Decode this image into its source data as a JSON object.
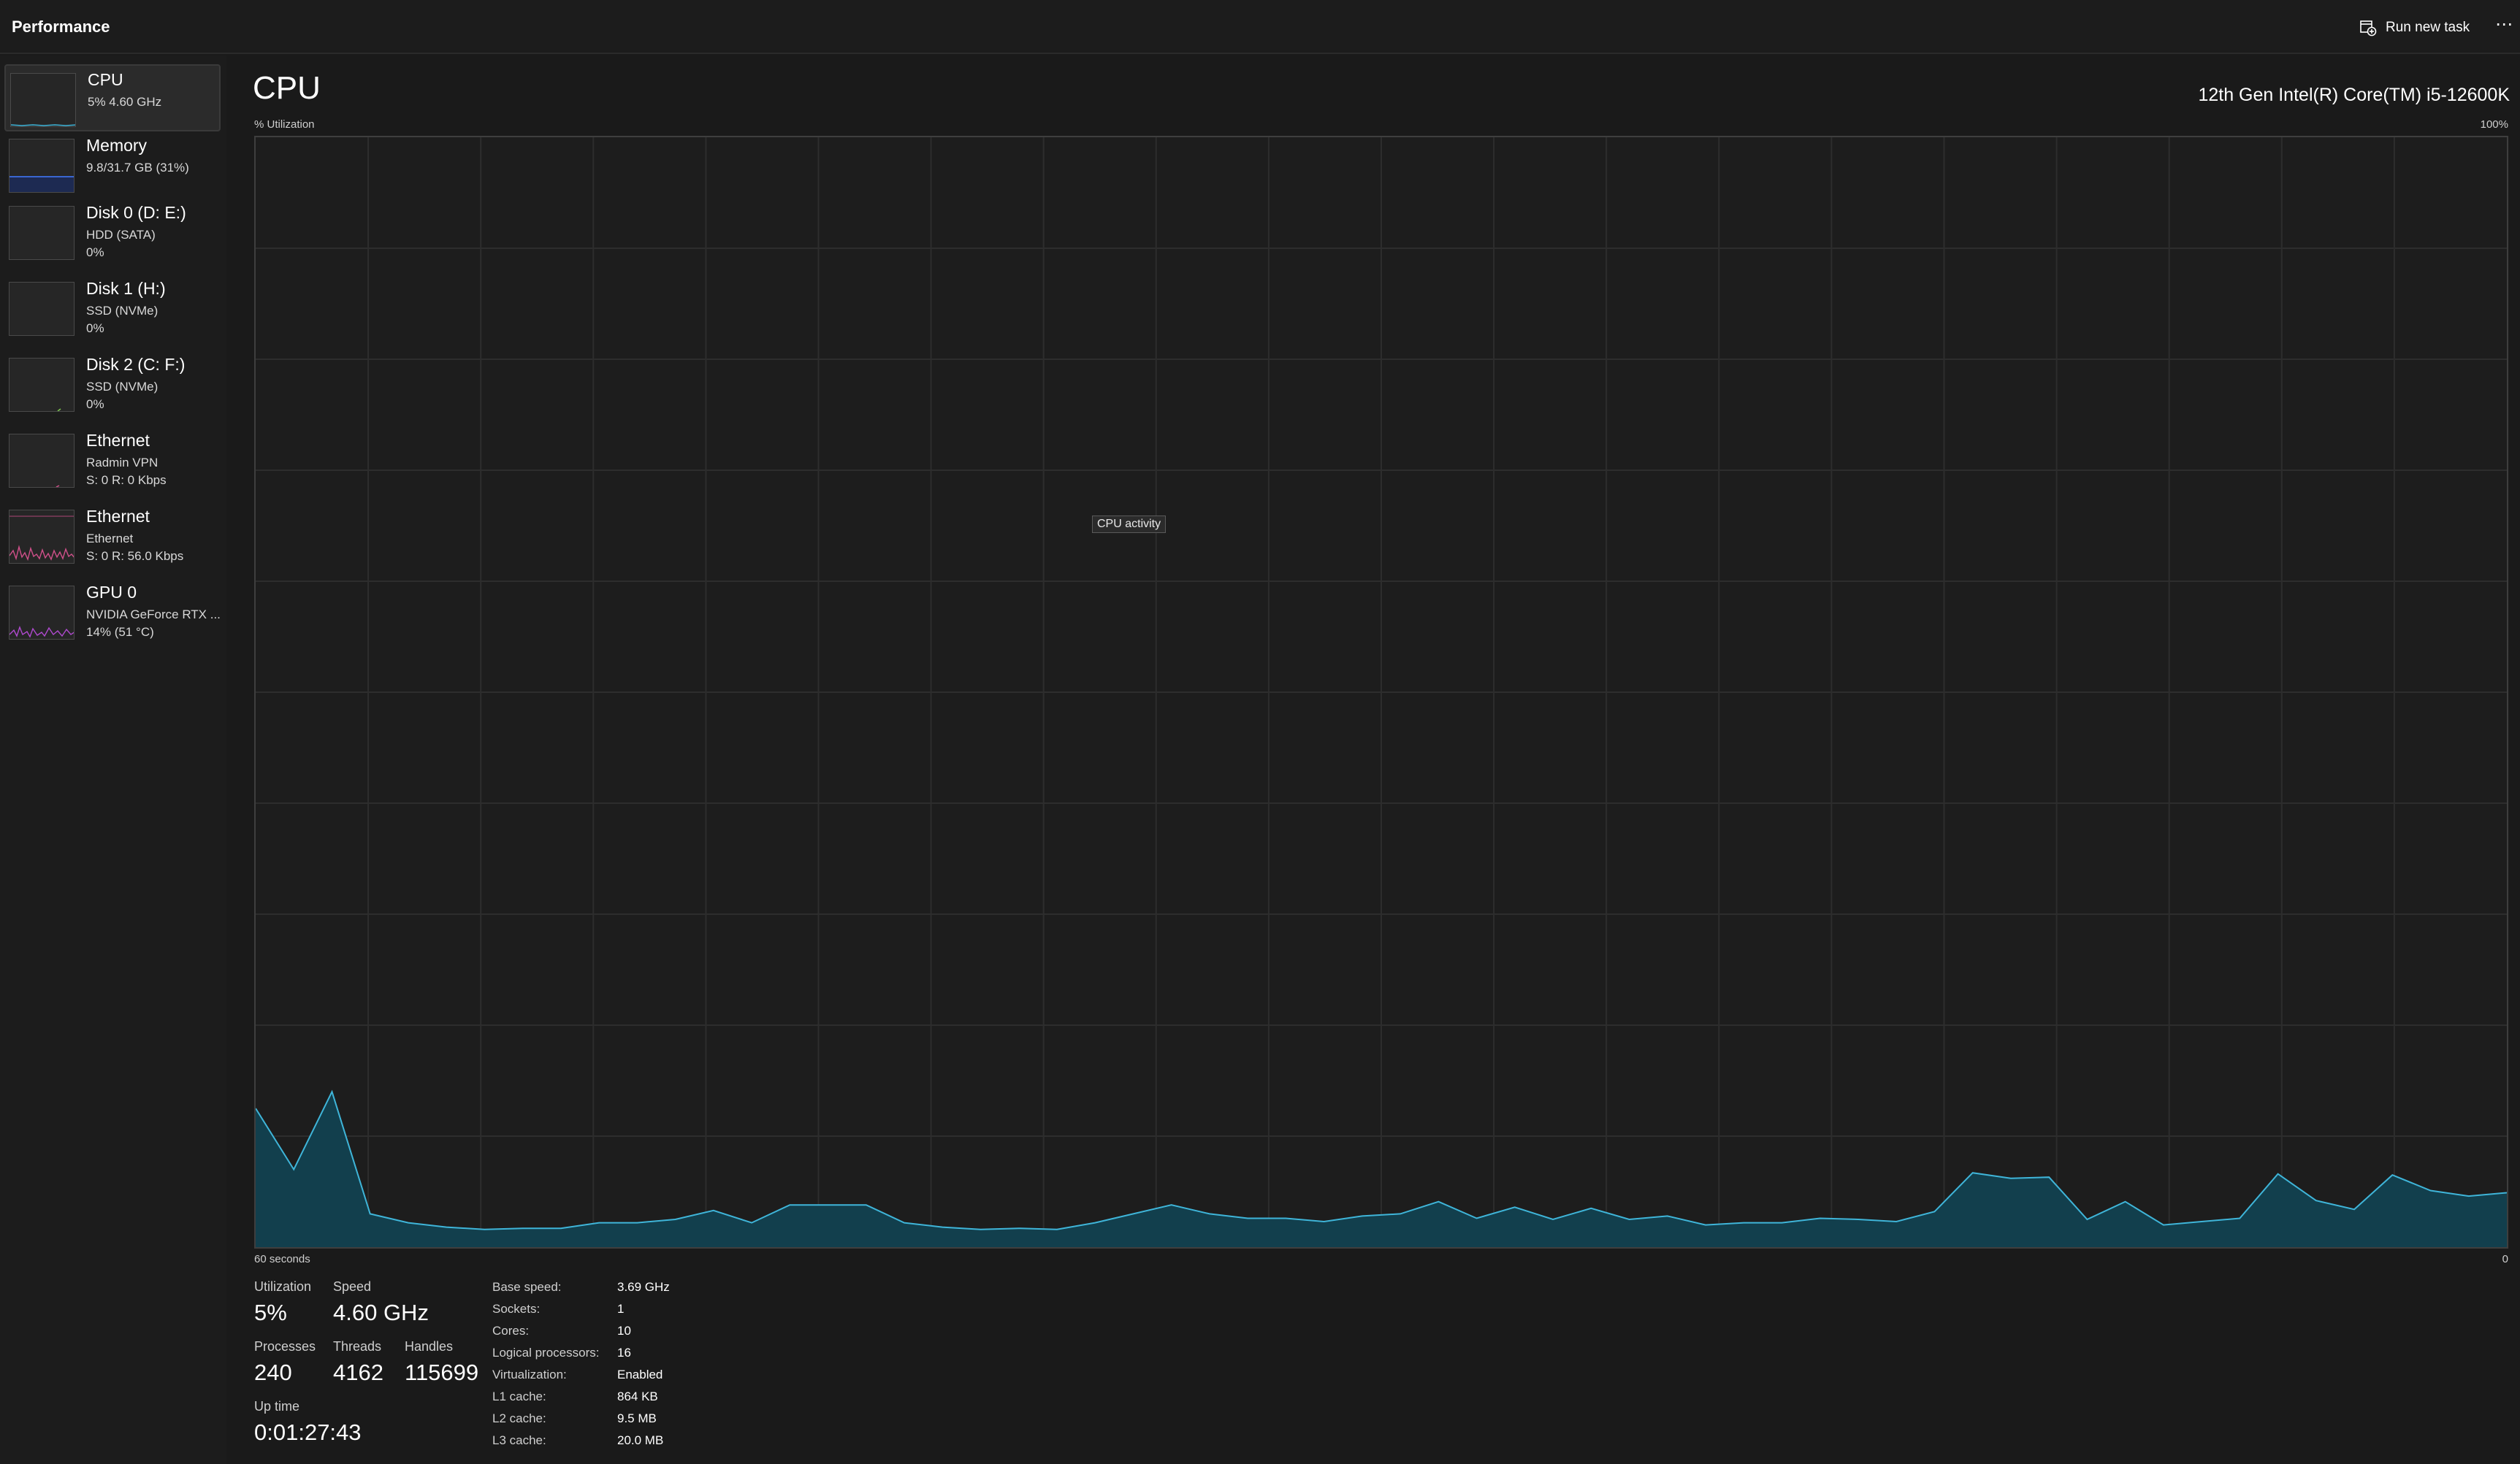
{
  "header": {
    "title": "Performance",
    "run_new_task_label": "Run new task",
    "more_label": "⋯"
  },
  "sidebar": {
    "items": [
      {
        "name": "CPU",
        "lines": [
          "5%  4.60 GHz"
        ],
        "selected": true,
        "color": "#3fb5d9"
      },
      {
        "name": "Memory",
        "lines": [
          "9.8/31.7 GB (31%)"
        ],
        "color": "#3a66d0"
      },
      {
        "name": "Disk 0 (D: E:)",
        "lines": [
          "HDD (SATA)",
          "0%"
        ],
        "color": "#7ec850"
      },
      {
        "name": "Disk 1 (H:)",
        "lines": [
          "SSD (NVMe)",
          "0%"
        ],
        "color": "#7ec850"
      },
      {
        "name": "Disk 2 (C: F:)",
        "lines": [
          "SSD (NVMe)",
          "0%"
        ],
        "color": "#7ec850"
      },
      {
        "name": "Ethernet",
        "lines": [
          "Radmin VPN",
          "S: 0  R: 0 Kbps"
        ],
        "color": "#d0508a"
      },
      {
        "name": "Ethernet",
        "lines": [
          "Ethernet",
          "S: 0  R: 56.0 Kbps"
        ],
        "color": "#d0508a"
      },
      {
        "name": "GPU 0",
        "lines": [
          "NVIDIA GeForce RTX ...",
          "14%  (51 °C)"
        ],
        "color": "#b04ad0"
      }
    ]
  },
  "main": {
    "title": "CPU",
    "cpu_model": "12th Gen Intel(R) Core(TM) i5-12600K",
    "y_axis_label": "% Utilization",
    "y_max_label": "100%",
    "x_left_label": "60 seconds",
    "x_right_label": "0",
    "tooltip": "CPU activity"
  },
  "chart_data": {
    "type": "area",
    "title": "",
    "ylabel": "% Utilization",
    "xlabel": "60 seconds",
    "x_range": [
      60,
      0
    ],
    "ylim": [
      0,
      100
    ],
    "grid": true,
    "color": "#3fb5d9",
    "values": [
      12.5,
      7,
      14,
      3,
      2.2,
      1.8,
      1.6,
      1.7,
      1.7,
      2.2,
      2.2,
      2.5,
      3.3,
      2.2,
      3.8,
      3.8,
      3.8,
      2.2,
      1.8,
      1.6,
      1.7,
      1.6,
      2.2,
      3,
      3.8,
      3,
      2.6,
      2.6,
      2.3,
      2.8,
      3,
      4.1,
      2.6,
      3.6,
      2.5,
      3.5,
      2.5,
      2.8,
      2,
      2.2,
      2.2,
      2.6,
      2.5,
      2.3,
      3.2,
      6.7,
      6.2,
      6.3,
      2.5,
      4.1,
      2,
      2.3,
      2.6,
      6.6,
      4.2,
      3.4,
      6.5,
      5.1,
      4.6,
      4.9
    ]
  },
  "stats": {
    "utilization": {
      "label": "Utilization",
      "value": "5%"
    },
    "speed": {
      "label": "Speed",
      "value": "4.60 GHz"
    },
    "processes": {
      "label": "Processes",
      "value": "240"
    },
    "threads": {
      "label": "Threads",
      "value": "4162"
    },
    "handles": {
      "label": "Handles",
      "value": "115699"
    },
    "uptime": {
      "label": "Up time",
      "value": "0:01:27:43"
    }
  },
  "specs": [
    {
      "key": "Base speed:",
      "value": "3.69 GHz"
    },
    {
      "key": "Sockets:",
      "value": "1"
    },
    {
      "key": "Cores:",
      "value": "10"
    },
    {
      "key": "Logical processors:",
      "value": "16"
    },
    {
      "key": "Virtualization:",
      "value": "Enabled"
    },
    {
      "key": "L1 cache:",
      "value": "864 KB"
    },
    {
      "key": "L2 cache:",
      "value": "9.5 MB"
    },
    {
      "key": "L3 cache:",
      "value": "20.0 MB"
    }
  ]
}
